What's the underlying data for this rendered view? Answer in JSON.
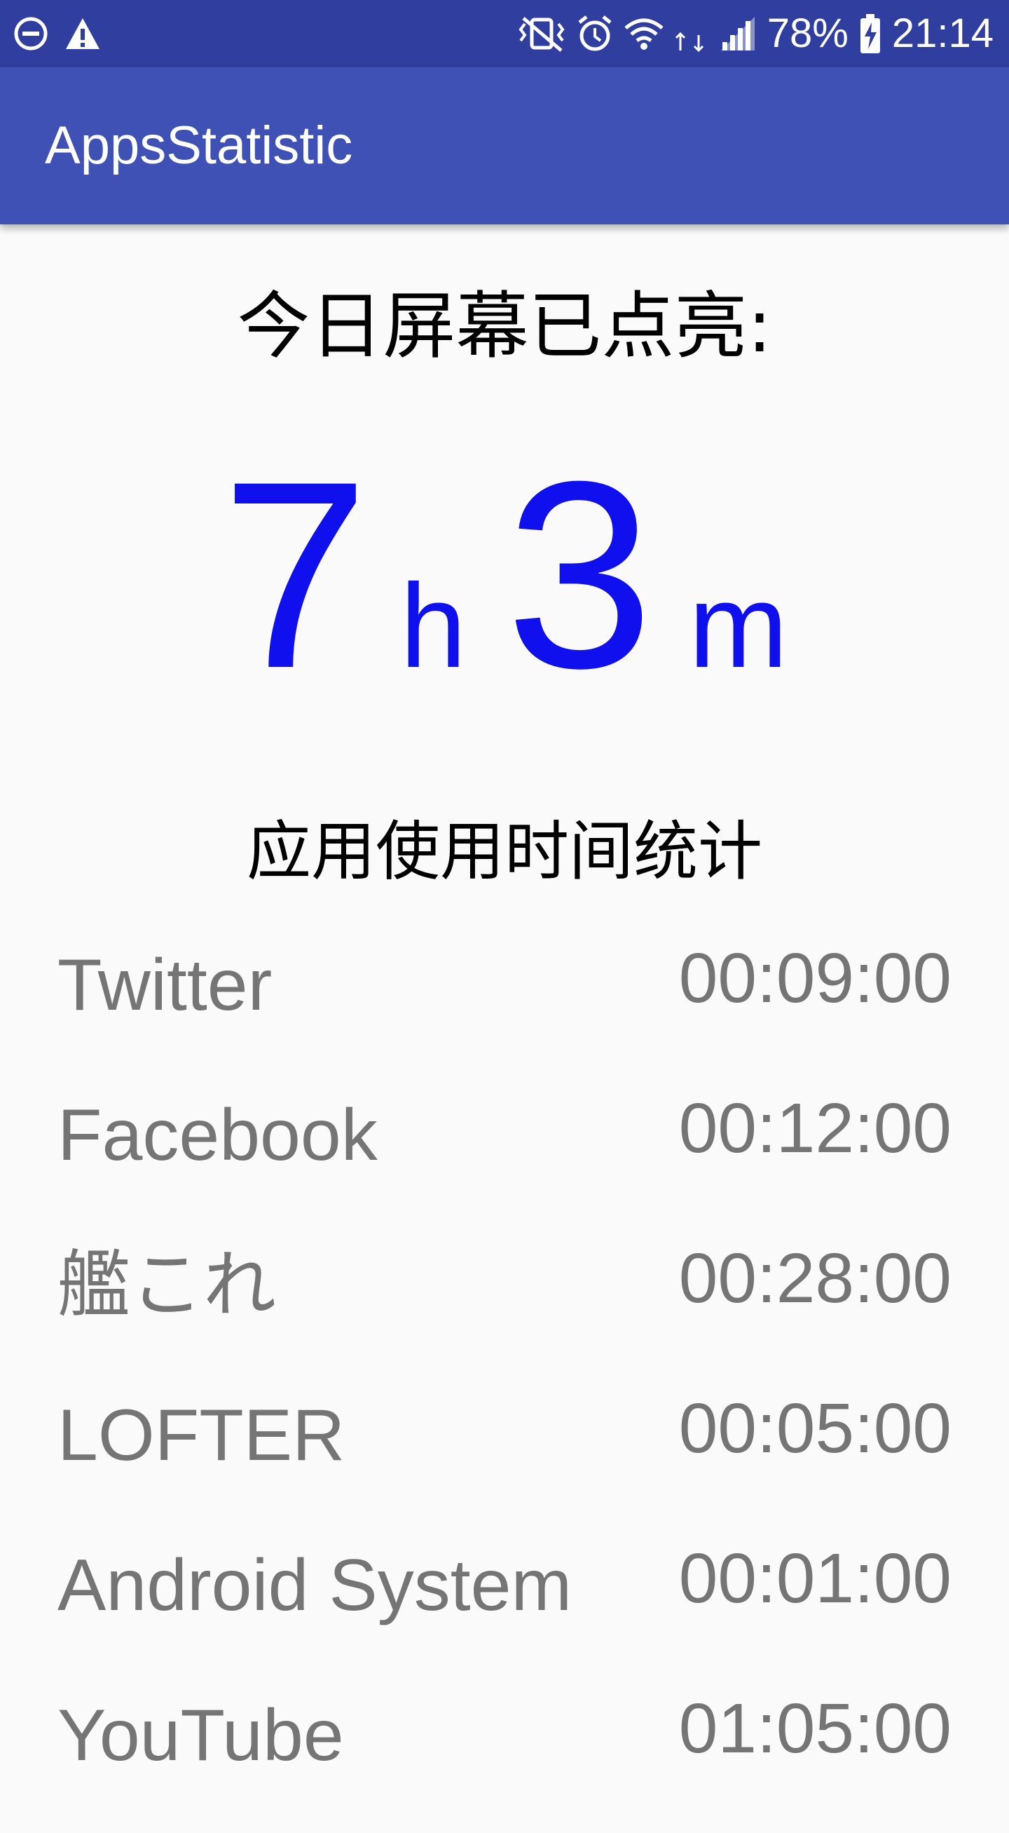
{
  "status_bar": {
    "battery_percent": "78%",
    "time": "21:14",
    "network_type": "4G",
    "icons": [
      "do-not-disturb-icon",
      "warning-icon",
      "vibrate-mute-icon",
      "alarm-icon",
      "wifi-icon",
      "network-4g-icon",
      "cell-signal-icon",
      "battery-charging-icon"
    ],
    "background_color": "#303f9f"
  },
  "toolbar": {
    "title": "AppsStatistic",
    "background_color": "#3f51b5"
  },
  "screen_on": {
    "heading": "今日屏幕已点亮:",
    "hours": "7",
    "hours_unit": "h",
    "minutes": "3",
    "minutes_unit": "m",
    "accent_color": "#1010ee"
  },
  "usage": {
    "heading": "应用使用时间统计",
    "items": [
      {
        "name": "Twitter",
        "time": "00:09:00"
      },
      {
        "name": "Facebook",
        "time": "00:12:00"
      },
      {
        "name": "艦これ",
        "time": "00:28:00"
      },
      {
        "name": "LOFTER",
        "time": "00:05:00"
      },
      {
        "name": "Android System",
        "time": "00:01:00"
      },
      {
        "name": "YouTube",
        "time": "01:05:00"
      }
    ]
  }
}
